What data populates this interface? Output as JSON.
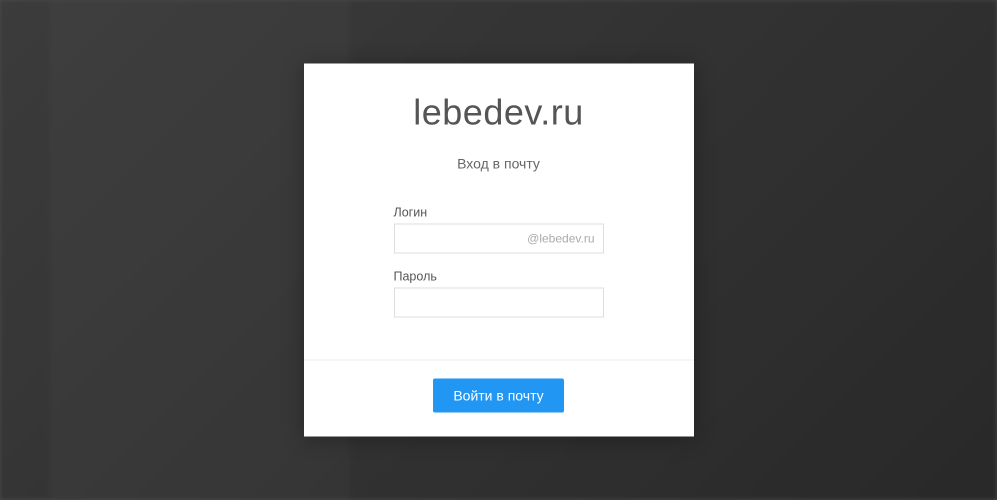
{
  "site": {
    "title": "lebedev.ru"
  },
  "modal": {
    "subtitle": "Вход в почту",
    "login_label": "Логин",
    "login_suffix": "@lebedev.ru",
    "login_value": "",
    "password_label": "Пароль",
    "password_value": "",
    "submit_label": "Войти в почту"
  }
}
